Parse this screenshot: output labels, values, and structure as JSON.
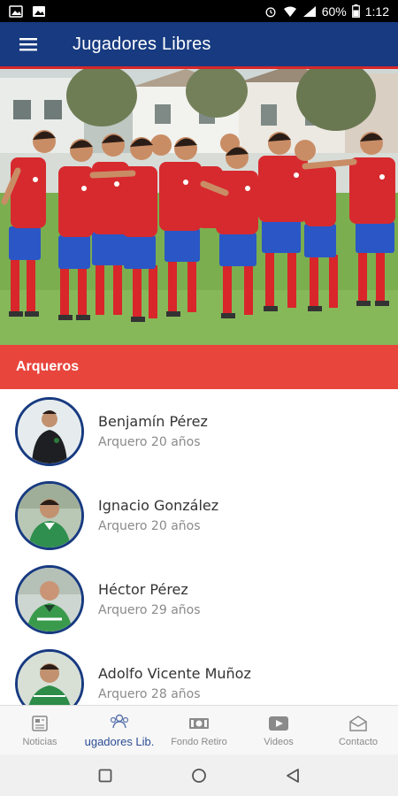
{
  "status_bar": {
    "battery": "60%",
    "time": "1:12"
  },
  "app_bar": {
    "title": "Jugadores Libres"
  },
  "section": {
    "title": "Arqueros"
  },
  "players": [
    {
      "name": "Benjamín Pérez",
      "detail": "Arquero 20 años"
    },
    {
      "name": "Ignacio González",
      "detail": "Arquero 20 años"
    },
    {
      "name": "Héctor Pérez",
      "detail": "Arquero 29 años"
    },
    {
      "name": "Adolfo Vicente Muñoz",
      "detail": "Arquero 28 años"
    }
  ],
  "bottom_nav": [
    {
      "label": "Noticias",
      "icon": "newspaper-icon",
      "active": false
    },
    {
      "label": "ugadores Lib.",
      "icon": "users-icon",
      "active": true
    },
    {
      "label": "Fondo Retiro",
      "icon": "money-icon",
      "active": false
    },
    {
      "label": "Videos",
      "icon": "play-icon",
      "active": false
    },
    {
      "label": "Contacto",
      "icon": "mail-icon",
      "active": false
    }
  ],
  "colors": {
    "primary": "#173a80",
    "accent_red": "#d8262b",
    "section_red": "#e8453c",
    "active_nav": "#2b4d93"
  }
}
